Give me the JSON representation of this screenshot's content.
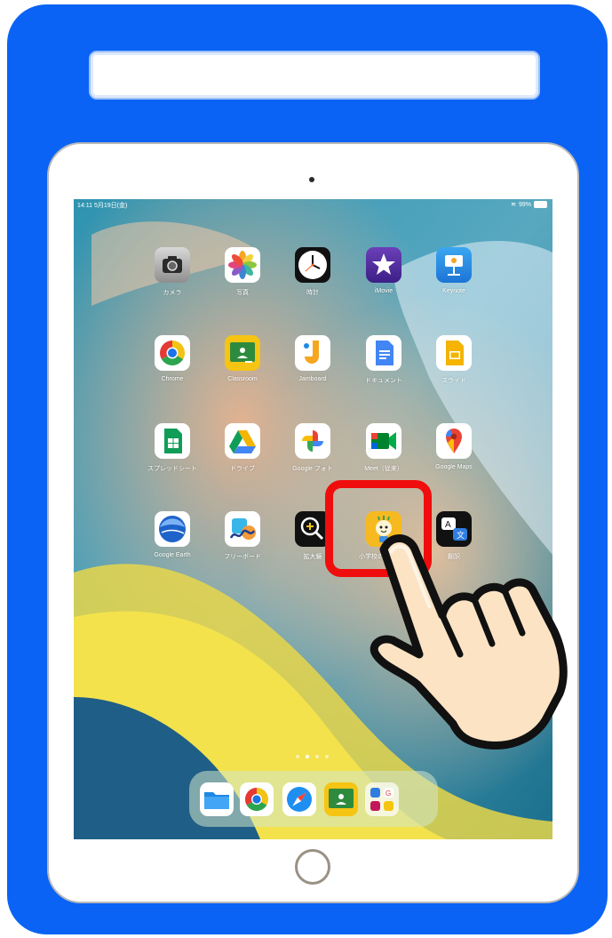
{
  "status_bar": {
    "time_date": "14:11  5月19日(金)",
    "battery": "99%"
  },
  "apps": [
    {
      "label": "カメラ",
      "icon": "camera-icon"
    },
    {
      "label": "写真",
      "icon": "photos-icon"
    },
    {
      "label": "時計",
      "icon": "clock-icon"
    },
    {
      "label": "iMovie",
      "icon": "imovie-icon"
    },
    {
      "label": "Keynote",
      "icon": "keynote-icon"
    },
    {
      "label": "Chrome",
      "icon": "chrome-icon"
    },
    {
      "label": "Classroom",
      "icon": "classroom-icon"
    },
    {
      "label": "Jamboard",
      "icon": "jamboard-icon"
    },
    {
      "label": "ドキュメント",
      "icon": "docs-icon"
    },
    {
      "label": "スライド",
      "icon": "slides-icon"
    },
    {
      "label": "スプレッドシート",
      "icon": "sheets-icon"
    },
    {
      "label": "ドライブ",
      "icon": "drive-icon"
    },
    {
      "label": "Google フォト",
      "icon": "google-photos-icon"
    },
    {
      "label": "Meet（従来）",
      "icon": "meet-icon"
    },
    {
      "label": "Google Maps",
      "icon": "maps-icon"
    },
    {
      "label": "Google Earth",
      "icon": "earth-icon"
    },
    {
      "label": "フリーボード",
      "icon": "freeform-icon"
    },
    {
      "label": "拡大鏡",
      "icon": "magnifier-icon"
    },
    {
      "label": "小学校の学習メ…",
      "icon": "learning-app-icon"
    },
    {
      "label": "翻訳",
      "icon": "translate-icon"
    }
  ],
  "dock": [
    "files-icon",
    "chrome-icon",
    "safari-icon",
    "classroom-icon",
    "app-library-icon"
  ],
  "page_dots": {
    "count": 4,
    "active": 2
  },
  "colors": {
    "card": "#0a63f5",
    "highlight": "#f00d0d",
    "hand_fill": "#fbe3c4"
  }
}
